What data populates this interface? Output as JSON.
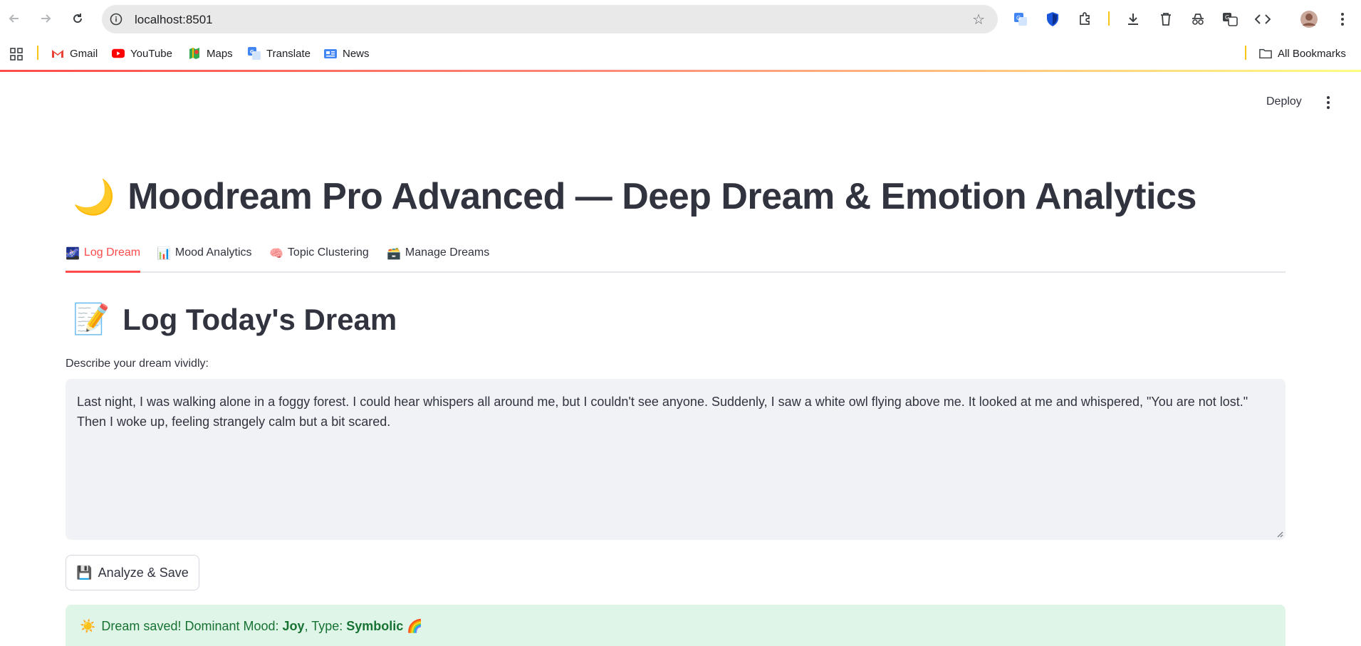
{
  "browser": {
    "url": "localhost:8501",
    "bookmarks": [
      {
        "label": "Gmail",
        "icon": "gmail-icon"
      },
      {
        "label": "YouTube",
        "icon": "youtube-icon"
      },
      {
        "label": "Maps",
        "icon": "maps-icon"
      },
      {
        "label": "Translate",
        "icon": "translate-icon"
      },
      {
        "label": "News",
        "icon": "news-icon"
      }
    ],
    "all_bookmarks": "All Bookmarks"
  },
  "app": {
    "deploy_label": "Deploy",
    "title": "Moodream Pro Advanced — Deep Dream & Emotion Analytics",
    "title_emoji": "🌙",
    "tabs": [
      {
        "label": "Log Dream",
        "emoji": "🌌",
        "active": true
      },
      {
        "label": "Mood Analytics",
        "emoji": "📊",
        "active": false
      },
      {
        "label": "Topic Clustering",
        "emoji": "🧠",
        "active": false
      },
      {
        "label": "Manage Dreams",
        "emoji": "🗃️",
        "active": false
      }
    ],
    "section_title": "Log Today's Dream",
    "section_emoji": "📝",
    "input_label": "Describe your dream vividly:",
    "dream_text": "Last night, I was walking alone in a foggy forest. I could hear whispers all around me, but I couldn't see anyone. Suddenly, I saw a white owl flying above me. It looked at me and whispered, \"You are not lost.\" Then I woke up, feeling strangely calm but a bit scared.",
    "button_emoji": "💾",
    "button_label": "Analyze & Save",
    "success": {
      "emoji": "☀️",
      "prefix": "Dream saved! Dominant Mood: ",
      "mood": "Joy",
      "mid": ", Type: ",
      "type": "Symbolic",
      "suffix_emoji": "🌈"
    }
  },
  "colors": {
    "accent": "#ff4b4b",
    "text": "#31333f",
    "success_bg": "#dff5e7",
    "success_text": "#177233",
    "input_bg": "#f0f2f6"
  }
}
